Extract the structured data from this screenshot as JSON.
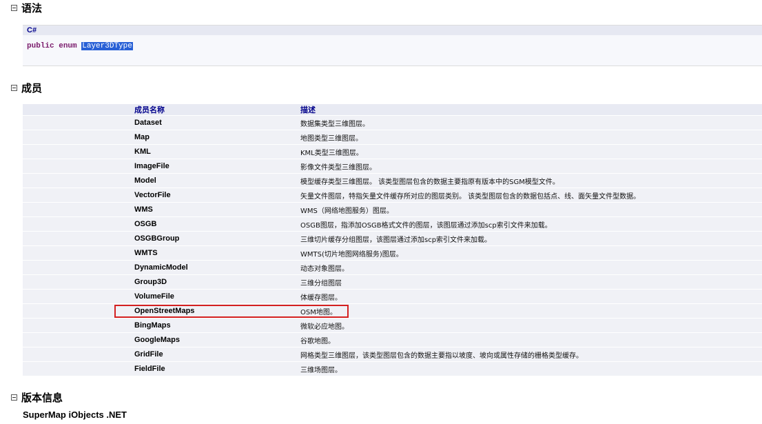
{
  "syntax": {
    "title": "语法",
    "language": "C#",
    "keyword1": "public",
    "keyword2": "enum",
    "type_name": "Layer3DType"
  },
  "members": {
    "title": "成员",
    "columns": [
      "成员名称",
      "描述"
    ],
    "rows": [
      {
        "name": "Dataset",
        "desc": "数据集类型三维图层。"
      },
      {
        "name": "Map",
        "desc": "地图类型三维图层。"
      },
      {
        "name": "KML",
        "desc": "KML类型三维图层。"
      },
      {
        "name": "ImageFile",
        "desc": "影像文件类型三维图层。"
      },
      {
        "name": "Model",
        "desc": "模型缓存类型三维图层。 该类型图层包含的数据主要指原有版本中的SGM模型文件。"
      },
      {
        "name": "VectorFile",
        "desc": "矢量文件图层，特指矢量文件缓存所对应的图层类别。 该类型图层包含的数据包括点、线、面矢量文件型数据。"
      },
      {
        "name": "WMS",
        "desc": "WMS（网络地图服务）图层。"
      },
      {
        "name": "OSGB",
        "desc": "OSGB图层，指添加OSGB格式文件的图层，该图层通过添加scp索引文件来加载。"
      },
      {
        "name": "OSGBGroup",
        "desc": "三维切片缓存分组图层，该图层通过添加scp索引文件来加载。"
      },
      {
        "name": "WMTS",
        "desc": "WMTS(切片地图网络服务)图层。"
      },
      {
        "name": "DynamicModel",
        "desc": "动态对象图层。"
      },
      {
        "name": "Group3D",
        "desc": "三维分组图层"
      },
      {
        "name": "VolumeFile",
        "desc": "体缓存图层。"
      },
      {
        "name": "OpenStreetMaps",
        "desc": "OSM地图。"
      },
      {
        "name": "BingMaps",
        "desc": "微软必应地图。"
      },
      {
        "name": "GoogleMaps",
        "desc": "谷歌地图。"
      },
      {
        "name": "GridFile",
        "desc": "网格类型三维图层，该类型图层包含的数据主要指以坡度、坡向或属性存储的栅格类型缓存。"
      },
      {
        "name": "FieldFile",
        "desc": "三维场图层。"
      }
    ]
  },
  "version": {
    "title": "版本信息",
    "product": "SuperMap iObjects .NET"
  },
  "colors": {
    "highlight_border": "#d42020",
    "selection": "#2860d6",
    "header_text": "#00008b"
  }
}
